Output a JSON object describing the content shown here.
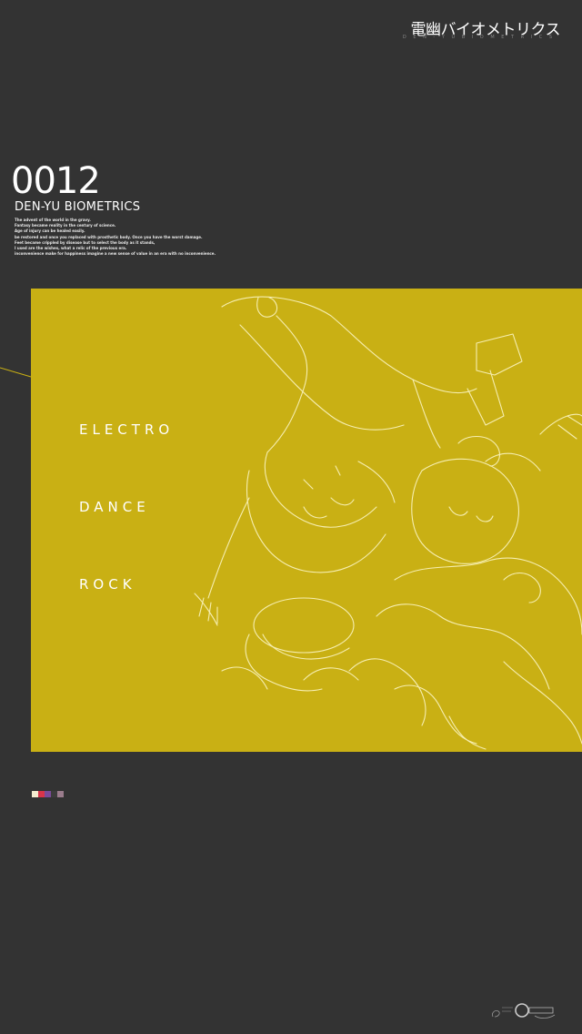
{
  "header": {
    "logo_text": "電幽バイオメトリクス",
    "logo_subtext": "D E N - Y U   B I O M E T R I C S"
  },
  "intro": {
    "number": "0012",
    "title": "DEN-YU BIOMETRICS",
    "description_lines": [
      "The advent of the world in the gravy.",
      "Fantasy became reality in the century of science.",
      "Age of injury can be healed easily.",
      "be restored and once you replaced with prosthetic body. Once you have the worst damage.",
      "Feet became crippled by disease but to select the body as it stands,",
      "I used are the wishes, what a relic of the previous era.",
      "inconvenience make for happiness imagine a new sense of value in an era with no inconvenience."
    ]
  },
  "panel": {
    "background": "#c9b014",
    "words": [
      "ELECTRO",
      "DANCE",
      "ROCK"
    ]
  },
  "palette": [
    "#f4ecd0",
    "#d8344a",
    "#7a4a9a",
    "#3c3c3c",
    "#9a7c8c"
  ],
  "footer": {
    "brand": "Cool"
  }
}
